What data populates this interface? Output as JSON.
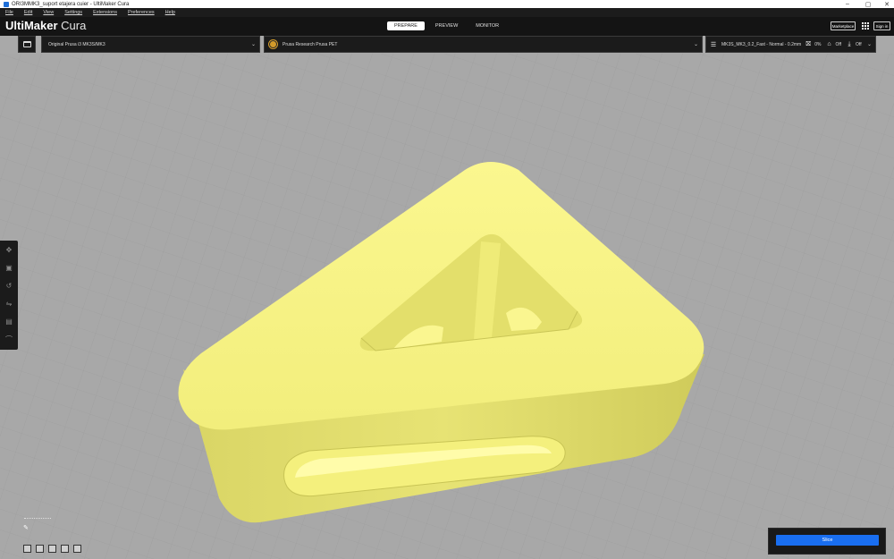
{
  "window": {
    "title": "ORI3MMK3_suport etajera cuier - UltiMaker Cura",
    "controls": [
      "–",
      "▢",
      "✕"
    ]
  },
  "menu": [
    "File",
    "Edit",
    "View",
    "Settings",
    "Extensions",
    "Preferences",
    "Help"
  ],
  "header": {
    "logo_bold": "UltiMaker",
    "logo_light": " Cura",
    "tabs": [
      {
        "label": "PREPARE",
        "active": true
      },
      {
        "label": "PREVIEW",
        "active": false
      },
      {
        "label": "MONITOR",
        "active": false
      }
    ],
    "marketplace": "Marketplace",
    "sign_in": "Sign in"
  },
  "toolbar": {
    "printer": "Original Prusa i3 MK3S/MK3",
    "material": "Prusa Research Prusa PET",
    "profile": "MK3S_MK3_0.2_Fast - Normal - 0.2mm",
    "infill": "0%",
    "support": "Off",
    "adhesion": "Off"
  },
  "colors": {
    "model": "#f6f283",
    "accent": "#196ef0",
    "material_swatch": "#d39b2a"
  },
  "icons": {
    "open": "folder-icon",
    "profile": "sliders-icon",
    "infill": "infill-icon",
    "support": "support-icon",
    "adhesion": "adhesion-icon"
  },
  "slice": {
    "label": "Slice"
  }
}
